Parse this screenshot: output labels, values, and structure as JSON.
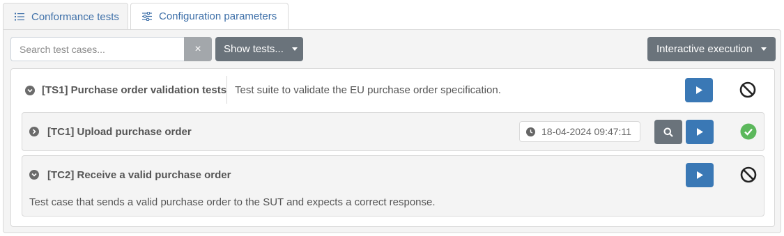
{
  "tabs": [
    {
      "label": "Conformance tests",
      "icon": "list-icon",
      "active": true
    },
    {
      "label": "Configuration parameters",
      "icon": "sliders-icon",
      "active": false
    }
  ],
  "toolbar": {
    "search_placeholder": "Search test cases...",
    "search_value": "",
    "clear_label": "×",
    "show_tests_label": "Show tests...",
    "interactive_label": "Interactive execution"
  },
  "suite": {
    "title": "[TS1] Purchase order validation tests",
    "description": "Test suite to validate the EU purchase order specification.",
    "status": "not-run",
    "test_cases": [
      {
        "title": "[TC1] Upload purchase order",
        "timestamp": "18-04-2024 09:47:11",
        "status": "success",
        "description": ""
      },
      {
        "title": "[TC2] Receive a valid purchase order",
        "description": "Test case that sends a valid purchase order to the SUT and expects a correct response.",
        "status": "not-run"
      }
    ]
  },
  "colors": {
    "primary": "#3a78b5",
    "secondary": "#6a737b",
    "success": "#5cb85c",
    "link": "#3d6fa8"
  }
}
